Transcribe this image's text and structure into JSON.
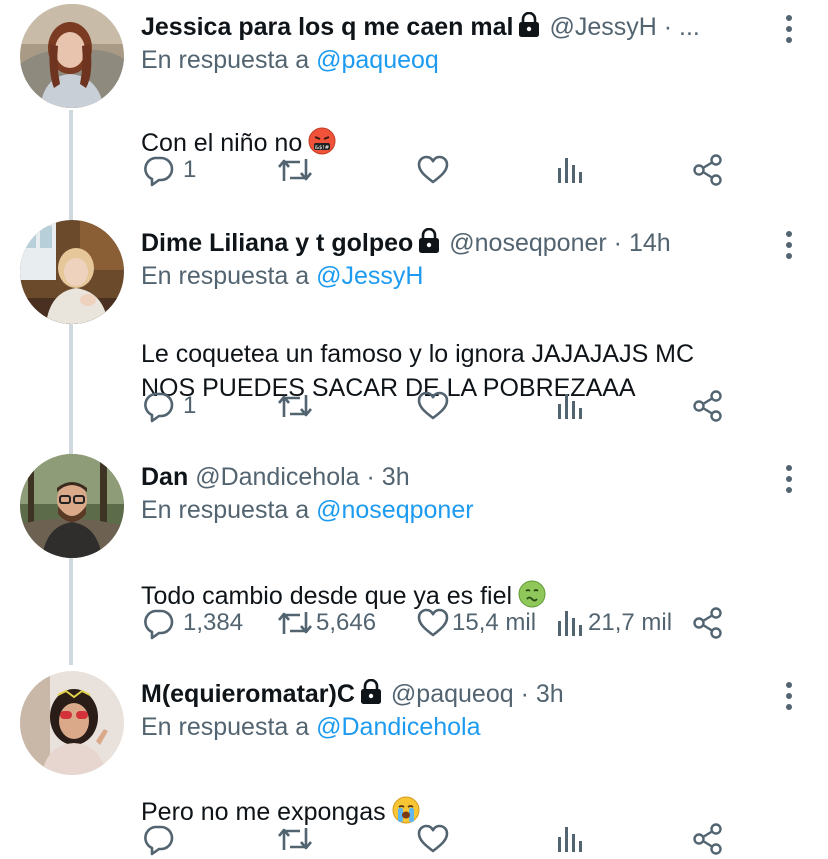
{
  "colors": {
    "text": "#0f1419",
    "secondary": "#536471",
    "link": "#1d9bf0",
    "thread_line": "#cfd9de"
  },
  "tweets": [
    {
      "display_name": "Jessica para los q me caen mal",
      "locked": true,
      "handle": "@JessyH",
      "separator": "·",
      "time": "...",
      "reply_prefix": "En respuesta a",
      "reply_to": "@paqueoq",
      "text": "Con el niño no",
      "emoji": "face-with-symbols-on-mouth-emoji",
      "replies": "1",
      "retweets": "",
      "likes": "",
      "views": "",
      "avatar": "avatar-jessica"
    },
    {
      "display_name": "Dime Liliana y t golpeo",
      "locked": true,
      "handle": "@noseqponer",
      "separator": "·",
      "time": "14h",
      "reply_prefix": "En respuesta a",
      "reply_to": "@JessyH",
      "text": "Le coquetea un famoso y lo ignora JAJAJAJS MC\nNOS PUEDES SACAR DE LA POBREZAAA",
      "emoji": "",
      "replies": "1",
      "retweets": "",
      "likes": "",
      "views": "",
      "avatar": "avatar-liliana"
    },
    {
      "display_name": "Dan",
      "locked": false,
      "handle": "@Dandicehola",
      "separator": "·",
      "time": "3h",
      "reply_prefix": "En respuesta a",
      "reply_to": "@noseqponer",
      "text": "Todo cambio desde que ya es fiel",
      "emoji": "nauseated-face-emoji",
      "replies": "1,384",
      "retweets": "5,646",
      "likes": "15,4 mil",
      "views": "21,7 mil",
      "avatar": "avatar-dan"
    },
    {
      "display_name": "M(equieromatar)C",
      "locked": true,
      "handle": "@paqueoq",
      "separator": "·",
      "time": "3h",
      "reply_prefix": "En respuesta a",
      "reply_to": "@Dandicehola",
      "text": "Pero no me expongas",
      "emoji": "loudly-crying-face-emoji",
      "replies": "",
      "retweets": "",
      "likes": "",
      "views": "",
      "avatar": "avatar-mc"
    }
  ]
}
